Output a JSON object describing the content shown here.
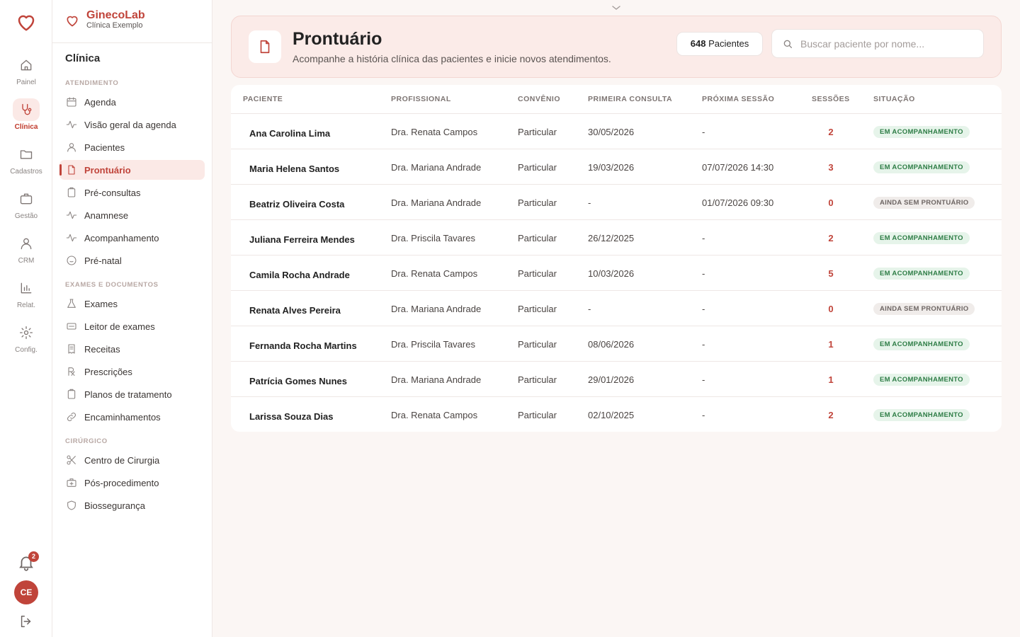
{
  "rail": {
    "items": [
      {
        "label": "Painel",
        "icon": "home-icon"
      },
      {
        "label": "Clínica",
        "icon": "stethoscope-icon",
        "active": true
      },
      {
        "label": "Cadastros",
        "icon": "folder-icon"
      },
      {
        "label": "Gestão",
        "icon": "briefcase-icon"
      },
      {
        "label": "CRM",
        "icon": "users-icon"
      },
      {
        "label": "Relat.",
        "icon": "bar-chart-icon"
      },
      {
        "label": "Config.",
        "icon": "gear-icon"
      }
    ],
    "notifications": "2",
    "avatar": "CE"
  },
  "brand": {
    "name": "GinecoLab",
    "subtitle": "Clínica Exemplo"
  },
  "sidebar": {
    "title": "Clínica",
    "sections": [
      {
        "title": "ATENDIMENTO",
        "items": [
          {
            "label": "Agenda",
            "icon": "calendar-icon"
          },
          {
            "label": "Visão geral da agenda",
            "icon": "activity-icon"
          },
          {
            "label": "Pacientes",
            "icon": "user-icon"
          },
          {
            "label": "Prontuário",
            "icon": "file-icon",
            "active": true
          },
          {
            "label": "Pré-consultas",
            "icon": "clipboard-icon"
          },
          {
            "label": "Anamnese",
            "icon": "activity-icon"
          },
          {
            "label": "Acompanhamento",
            "icon": "activity-icon"
          },
          {
            "label": "Pré-natal",
            "icon": "baby-icon"
          }
        ]
      },
      {
        "title": "EXAMES E DOCUMENTOS",
        "items": [
          {
            "label": "Exames",
            "icon": "flask-icon"
          },
          {
            "label": "Leitor de exames",
            "icon": "scanner-icon"
          },
          {
            "label": "Receitas",
            "icon": "receipt-icon"
          },
          {
            "label": "Prescrições",
            "icon": "rx-icon"
          },
          {
            "label": "Planos de tratamento",
            "icon": "clipboard-icon"
          },
          {
            "label": "Encaminhamentos",
            "icon": "link-icon"
          }
        ]
      },
      {
        "title": "CIRÚRGICO",
        "items": [
          {
            "label": "Centro de Cirurgia",
            "icon": "scissors-icon"
          },
          {
            "label": "Pós-procedimento",
            "icon": "medkit-icon"
          },
          {
            "label": "Biossegurança",
            "icon": "shield-icon"
          }
        ]
      }
    ]
  },
  "header": {
    "title": "Prontuário",
    "subtitle": "Acompanhe a história clínica das pacientes e inicie novos atendimentos.",
    "count_number": "648",
    "count_label": " Pacientes",
    "search_placeholder": "Buscar paciente por nome..."
  },
  "table": {
    "columns": [
      "PACIENTE",
      "PROFISSIONAL",
      "CONVÊNIO",
      "PRIMEIRA CONSULTA",
      "PRÓXIMA SESSÃO",
      "SESSÕES",
      "SITUAÇÃO"
    ],
    "rows": [
      {
        "paciente": "Ana Carolina Lima",
        "profissional": "Dra. Renata Campos",
        "convenio": "Particular",
        "primeira": "30/05/2026",
        "proxima": "-",
        "sessoes": "2",
        "situacao": "EM ACOMPANHAMENTO",
        "status": "green"
      },
      {
        "paciente": "Maria Helena Santos",
        "profissional": "Dra. Mariana Andrade",
        "convenio": "Particular",
        "primeira": "19/03/2026",
        "proxima": "07/07/2026 14:30",
        "sessoes": "3",
        "situacao": "EM ACOMPANHAMENTO",
        "status": "green"
      },
      {
        "paciente": "Beatriz Oliveira Costa",
        "profissional": "Dra. Mariana Andrade",
        "convenio": "Particular",
        "primeira": "-",
        "proxima": "01/07/2026 09:30",
        "sessoes": "0",
        "situacao": "AINDA SEM PRONTUÁRIO",
        "status": "gray"
      },
      {
        "paciente": "Juliana Ferreira Mendes",
        "profissional": "Dra. Priscila Tavares",
        "convenio": "Particular",
        "primeira": "26/12/2025",
        "proxima": "-",
        "sessoes": "2",
        "situacao": "EM ACOMPANHAMENTO",
        "status": "green"
      },
      {
        "paciente": "Camila Rocha Andrade",
        "profissional": "Dra. Renata Campos",
        "convenio": "Particular",
        "primeira": "10/03/2026",
        "proxima": "-",
        "sessoes": "5",
        "situacao": "EM ACOMPANHAMENTO",
        "status": "green"
      },
      {
        "paciente": "Renata Alves Pereira",
        "profissional": "Dra. Mariana Andrade",
        "convenio": "Particular",
        "primeira": "-",
        "proxima": "-",
        "sessoes": "0",
        "situacao": "AINDA SEM PRONTUÁRIO",
        "status": "gray"
      },
      {
        "paciente": "Fernanda Rocha Martins",
        "profissional": "Dra. Priscila Tavares",
        "convenio": "Particular",
        "primeira": "08/06/2026",
        "proxima": "-",
        "sessoes": "1",
        "situacao": "EM ACOMPANHAMENTO",
        "status": "green"
      },
      {
        "paciente": "Patrícia Gomes Nunes",
        "profissional": "Dra. Mariana Andrade",
        "convenio": "Particular",
        "primeira": "29/01/2026",
        "proxima": "-",
        "sessoes": "1",
        "situacao": "EM ACOMPANHAMENTO",
        "status": "green"
      },
      {
        "paciente": "Larissa Souza Dias",
        "profissional": "Dra. Renata Campos",
        "convenio": "Particular",
        "primeira": "02/10/2025",
        "proxima": "-",
        "sessoes": "2",
        "situacao": "EM ACOMPANHAMENTO",
        "status": "green"
      }
    ]
  },
  "colors": {
    "accent": "#c0443a",
    "accent_soft": "#fbe9e6",
    "status_green": "#2e7d46"
  }
}
